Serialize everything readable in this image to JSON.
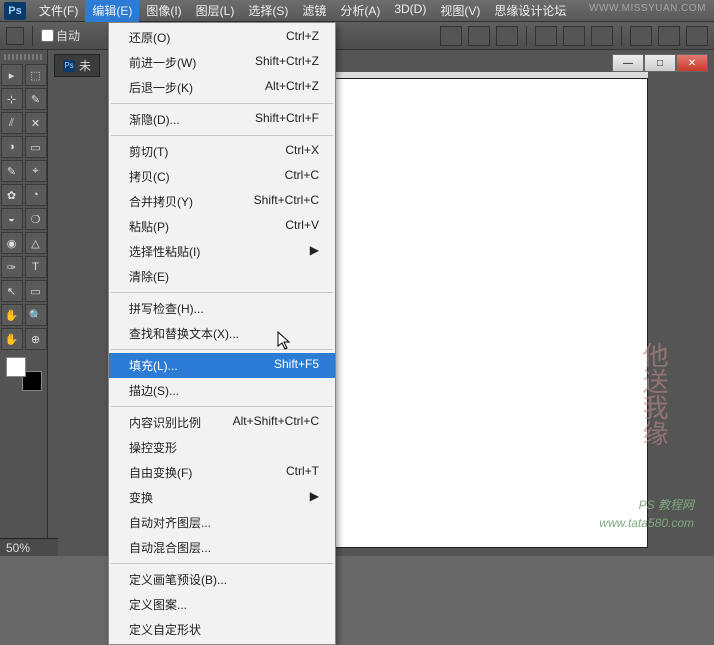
{
  "app": {
    "logo": "Ps"
  },
  "menubar": [
    {
      "label": "文件(F)"
    },
    {
      "label": "编辑(E)",
      "open": true
    },
    {
      "label": "图像(I)"
    },
    {
      "label": "图层(L)"
    },
    {
      "label": "选择(S)"
    },
    {
      "label": "滤镜"
    },
    {
      "label": "分析(A)"
    },
    {
      "label": "3D(D)"
    },
    {
      "label": "视图(V)"
    },
    {
      "label": "思缘设计论坛"
    }
  ],
  "watermark_top": "WWW.MISSYUAN.COM",
  "options": {
    "auto_label": "自动"
  },
  "doc_tab": {
    "icon": "Ps",
    "label": "未"
  },
  "window_btns": {
    "min": "—",
    "max": "□",
    "close": "✕"
  },
  "toolbox_rows": [
    [
      "▸",
      "⬚"
    ],
    [
      "⊹",
      "✎"
    ],
    [
      "⫽",
      "✕"
    ],
    [
      "◑",
      "▭"
    ],
    [
      "✎",
      "⌖"
    ],
    [
      "✿",
      "◔"
    ],
    [
      "◒",
      "❍"
    ],
    [
      "◉",
      "△"
    ],
    [
      "✑",
      "T"
    ],
    [
      "↖",
      "▭"
    ],
    [
      "✋",
      "🔍"
    ],
    [
      "✋",
      "⊕"
    ]
  ],
  "status": {
    "zoom": "50%"
  },
  "edit_menu": [
    {
      "label": "还原(O)",
      "shortcut": "Ctrl+Z"
    },
    {
      "label": "前进一步(W)",
      "shortcut": "Shift+Ctrl+Z"
    },
    {
      "label": "后退一步(K)",
      "shortcut": "Alt+Ctrl+Z"
    },
    {
      "sep": true
    },
    {
      "label": "渐隐(D)...",
      "shortcut": "Shift+Ctrl+F"
    },
    {
      "sep": true
    },
    {
      "label": "剪切(T)",
      "shortcut": "Ctrl+X"
    },
    {
      "label": "拷贝(C)",
      "shortcut": "Ctrl+C"
    },
    {
      "label": "合并拷贝(Y)",
      "shortcut": "Shift+Ctrl+C"
    },
    {
      "label": "粘贴(P)",
      "shortcut": "Ctrl+V"
    },
    {
      "label": "选择性粘贴(I)",
      "submenu": true
    },
    {
      "label": "清除(E)"
    },
    {
      "sep": true
    },
    {
      "label": "拼写检查(H)..."
    },
    {
      "label": "查找和替换文本(X)..."
    },
    {
      "sep": true
    },
    {
      "label": "填充(L)...",
      "shortcut": "Shift+F5",
      "highlight": true
    },
    {
      "label": "描边(S)..."
    },
    {
      "sep": true
    },
    {
      "label": "内容识别比例",
      "shortcut": "Alt+Shift+Ctrl+C"
    },
    {
      "label": "操控变形"
    },
    {
      "label": "自由变换(F)",
      "shortcut": "Ctrl+T"
    },
    {
      "label": "变换",
      "submenu": true
    },
    {
      "label": "自动对齐图层..."
    },
    {
      "label": "自动混合图层..."
    },
    {
      "sep": true
    },
    {
      "label": "定义画笔预设(B)..."
    },
    {
      "label": "定义图案..."
    },
    {
      "label": "定义自定形状"
    }
  ],
  "watermark_brush": "他送我缘",
  "watermark_foot_1": "PS 教程网",
  "watermark_foot_2": "www.tata580.com"
}
